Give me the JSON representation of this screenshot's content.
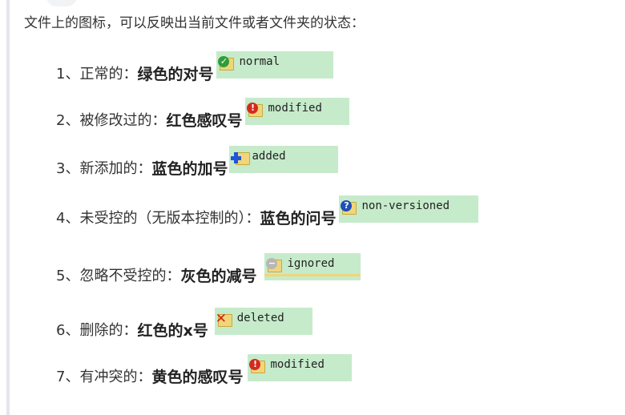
{
  "intro": "文件上的图标，可以反映出当前文件或者文件夹的状态：",
  "items": [
    {
      "num": "1、",
      "desc": "正常的：",
      "highlight": "绿色的对号",
      "icon": "green-check-icon",
      "status": "normal"
    },
    {
      "num": "2、",
      "desc": "被修改过的：",
      "highlight": "红色感叹号",
      "icon": "red-exclamation-icon",
      "status": "modified"
    },
    {
      "num": "3、",
      "desc": "新添加的：",
      "highlight": "蓝色的加号",
      "icon": "blue-plus-icon",
      "status": "added"
    },
    {
      "num": "4、",
      "desc": "未受控的（无版本控制的）：",
      "highlight": "蓝色的问号",
      "icon": "blue-question-icon",
      "status": "non-versioned"
    },
    {
      "num": "5、",
      "desc": "忽略不受控的：",
      "highlight": "灰色的减号",
      "icon": "gray-minus-icon",
      "status": "ignored"
    },
    {
      "num": "6、",
      "desc": "删除的：",
      "highlight": "红色的x号",
      "icon": "red-x-icon",
      "status": "deleted"
    },
    {
      "num": "7、",
      "desc": "有冲突的：",
      "highlight": "黄色的感叹号",
      "icon": "red-exclamation-icon",
      "status": "modified"
    }
  ],
  "colors": {
    "status_bg": "#c6ebcb",
    "quote_bar": "#e4e6eb"
  }
}
